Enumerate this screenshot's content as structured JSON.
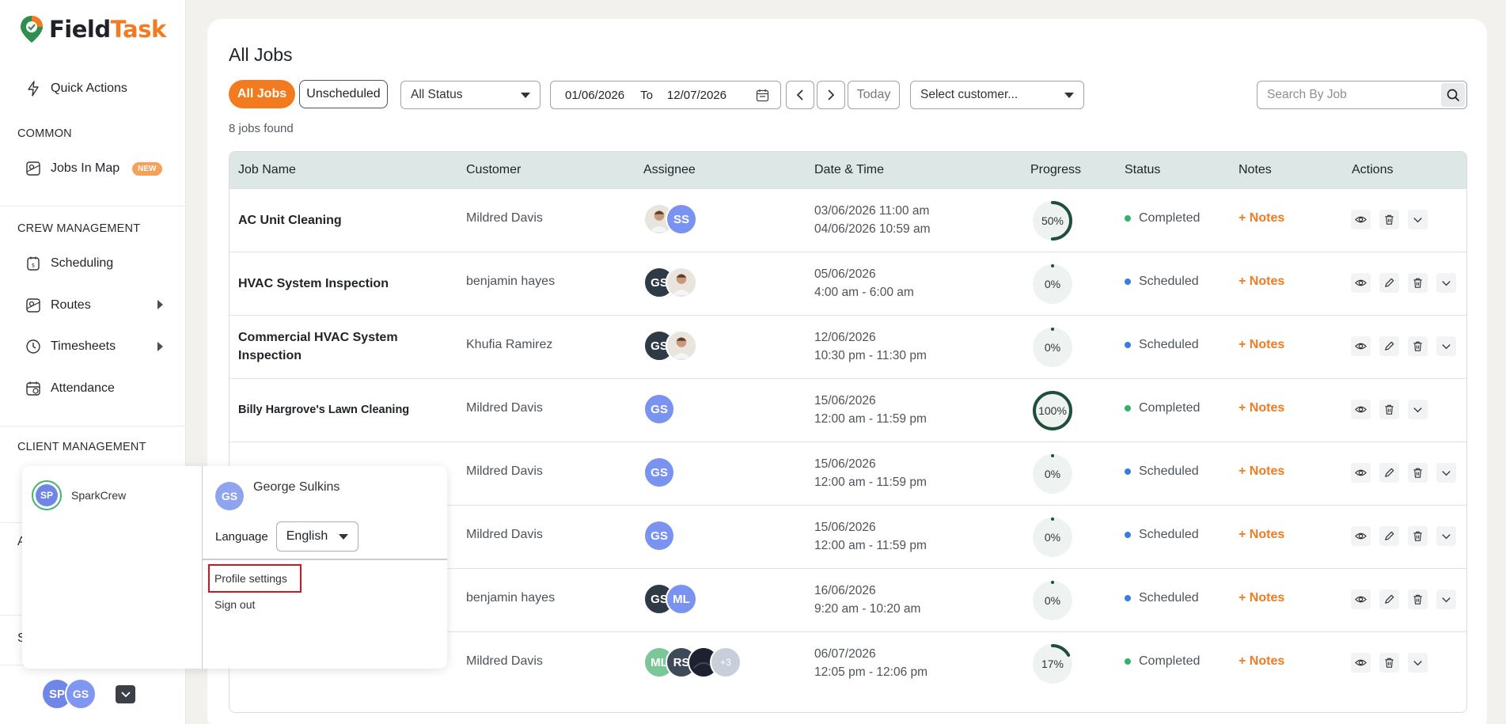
{
  "brand": {
    "name_part1": "Field",
    "name_part2": "Task",
    "accent": "#f27b1f"
  },
  "sidebar": {
    "quick_actions": "Quick Actions",
    "sections": {
      "common": "COMMON",
      "crew": "CREW MANAGEMENT",
      "client": "CLIENT MANAGEMENT"
    },
    "items": {
      "jobs_in_map": "Jobs In Map",
      "new_badge": "NEW",
      "scheduling": "Scheduling",
      "routes": "Routes",
      "timesheets": "Timesheets",
      "attendance": "Attendance"
    },
    "partial_letters": [
      "A",
      "S"
    ],
    "bottom_avatars": [
      "SP",
      "GS"
    ]
  },
  "popover": {
    "org_initials": "SP",
    "org_name": "SparkCrew",
    "user_initials": "GS",
    "user_name": "George Sulkins",
    "language_label": "Language",
    "language_value": "English",
    "profile_settings": "Profile settings",
    "sign_out": "Sign out"
  },
  "main": {
    "title": "All Jobs",
    "filters": {
      "all_jobs": "All Jobs",
      "unscheduled": "Unscheduled",
      "status_select": "All Status",
      "date_from": "01/06/2026",
      "date_to_label": "To",
      "date_to": "12/07/2026",
      "today": "Today",
      "customer_placeholder": "Select customer...",
      "search_placeholder": "Search By Job"
    },
    "jobs_count": "8 jobs found",
    "columns": [
      "Job Name",
      "Customer",
      "Assignee",
      "Date & Time",
      "Progress",
      "Status",
      "Notes",
      "Actions"
    ],
    "notes_label": "+ Notes",
    "status_colors": {
      "Completed": "#2fb36b",
      "Scheduled": "#3b7be8"
    },
    "rows": [
      {
        "job": "AC Unit Cleaning",
        "customer": "Mildred Davis",
        "assignees": [
          "photo",
          "SS"
        ],
        "date1": "03/06/2026 11:00 am",
        "date2": "04/06/2026 10:59 am",
        "progress": 50,
        "progress_label": "50%",
        "status": "Completed",
        "actions": [
          "view",
          "delete",
          "expand"
        ]
      },
      {
        "job": "HVAC System Inspection",
        "customer": "benjamin hayes",
        "assignees": [
          "GS",
          "photo"
        ],
        "date1": "05/06/2026",
        "date2": "4:00 am - 6:00 am",
        "progress": 0,
        "progress_label": "0%",
        "status": "Scheduled",
        "actions": [
          "view",
          "edit",
          "delete",
          "expand"
        ]
      },
      {
        "job_line1": "Commercial HVAC System",
        "job_line2": "Inspection",
        "customer": "Khufia Ramirez",
        "assignees": [
          "GS",
          "photo"
        ],
        "date1": "12/06/2026",
        "date2": "10:30 pm - 11:30 pm",
        "progress": 0,
        "progress_label": "0%",
        "status": "Scheduled",
        "actions": [
          "view",
          "edit",
          "delete",
          "expand"
        ]
      },
      {
        "job": "Billy Hargrove's Lawn Cleaning",
        "customer": "Mildred Davis",
        "assignees": [
          "GS"
        ],
        "date1": "15/06/2026",
        "date2": "12:00 am - 11:59 pm",
        "progress": 100,
        "progress_label": "100%",
        "status": "Completed",
        "actions": [
          "view",
          "delete",
          "expand"
        ]
      },
      {
        "job": "",
        "customer": "Mildred Davis",
        "assignees": [
          "GS"
        ],
        "date1": "15/06/2026",
        "date2": "12:00 am - 11:59 pm",
        "progress": 0,
        "progress_label": "0%",
        "status": "Scheduled",
        "actions": [
          "view",
          "edit",
          "delete",
          "expand"
        ]
      },
      {
        "job": "",
        "customer": "Mildred Davis",
        "assignees": [
          "GS"
        ],
        "date1": "15/06/2026",
        "date2": "12:00 am - 11:59 pm",
        "progress": 0,
        "progress_label": "0%",
        "status": "Scheduled",
        "actions": [
          "view",
          "edit",
          "delete",
          "expand"
        ]
      },
      {
        "job": "",
        "customer": "benjamin hayes",
        "assignees": [
          "GS",
          "ML"
        ],
        "date1": "16/06/2026",
        "date2": "9:20 am - 10:20 am",
        "progress": 0,
        "progress_label": "0%",
        "status": "Scheduled",
        "actions": [
          "view",
          "edit",
          "delete",
          "expand"
        ]
      },
      {
        "job": "",
        "customer": "Mildred Davis",
        "assignees": [
          "ML",
          "RS",
          "photo-dark",
          "+3"
        ],
        "date1": "06/07/2026",
        "date2": "12:05 pm - 12:06 pm",
        "progress": 17,
        "progress_label": "17%",
        "status": "Completed",
        "actions": [
          "view",
          "delete",
          "expand"
        ]
      }
    ]
  }
}
